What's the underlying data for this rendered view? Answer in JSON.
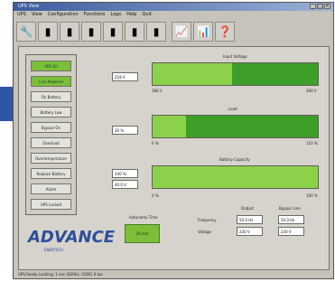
{
  "window": {
    "title": "UPS View"
  },
  "menu": [
    "UPS",
    "View",
    "Configuration",
    "Functions",
    "Logs",
    "Help",
    "Quit"
  ],
  "toolbar": {
    "buttons": [
      {
        "name": "wrench-button",
        "icon": "wrench-icon"
      },
      {
        "name": "tool-1-button",
        "icon": "ups-icon"
      },
      {
        "name": "tool-2-button",
        "icon": "ups-icon"
      },
      {
        "name": "tool-3-button",
        "icon": "ups-icon"
      },
      {
        "name": "tool-4-button",
        "icon": "ups-icon"
      },
      {
        "name": "tool-5-button",
        "icon": "ups-icon"
      },
      {
        "name": "tool-6-button",
        "icon": "ups-icon"
      },
      {
        "name": "graph-button",
        "icon": "graph-icon"
      },
      {
        "name": "chart-button",
        "icon": "chart-icon"
      },
      {
        "name": "help-button",
        "icon": "help-icon"
      }
    ]
  },
  "status_list": [
    {
      "label": "UPS On",
      "active": true
    },
    {
      "label": "Line Powered",
      "active": true
    },
    {
      "label": "On Battery",
      "active": false
    },
    {
      "label": "Battery Low",
      "active": false
    },
    {
      "label": "Bypass On",
      "active": false
    },
    {
      "label": "Overload",
      "active": false
    },
    {
      "label": "Overtemperature",
      "active": false
    },
    {
      "label": "Replace Battery",
      "active": false
    },
    {
      "label": "Alarm",
      "active": false
    },
    {
      "label": "UPS Locked",
      "active": false
    }
  ],
  "meters": {
    "input_voltage": {
      "title": "Input Voltage",
      "value": "218 V",
      "min": "180 V",
      "max": "260 V",
      "fraction": 0.48
    },
    "load": {
      "title": "Load",
      "value": "20 %",
      "min": "0 %",
      "max": "110 %",
      "fraction": 0.2
    },
    "battery_capacity": {
      "title": "Battery Capacity",
      "value": "100 %",
      "value2": "40.0 V",
      "min": "0 %",
      "max": "100 %",
      "fraction": 1.0
    }
  },
  "autonomy": {
    "label": "Autonomy Time",
    "value": "26 min"
  },
  "io_table": {
    "col_output": "Output",
    "col_bypass": "Bypass Line",
    "row_frequency": "Frequency",
    "row_voltage": "Voltage",
    "frequency_output": "50.0 Hz",
    "frequency_bypass": "50.0 Hz",
    "voltage_output": "230 V",
    "voltage_bypass": "230 V"
  },
  "logo": {
    "name": "ADVANCE",
    "sub": "ENERTECH"
  },
  "statusbar": {
    "text": "UPS Ready   Loading: 1 min   SERIAL: COM1 0 bar"
  },
  "colors": {
    "active": "#7bbf38",
    "bar_bg": "#3e9e2a",
    "bar_fill": "#8bd24a",
    "brand": "#2d4f9b"
  }
}
